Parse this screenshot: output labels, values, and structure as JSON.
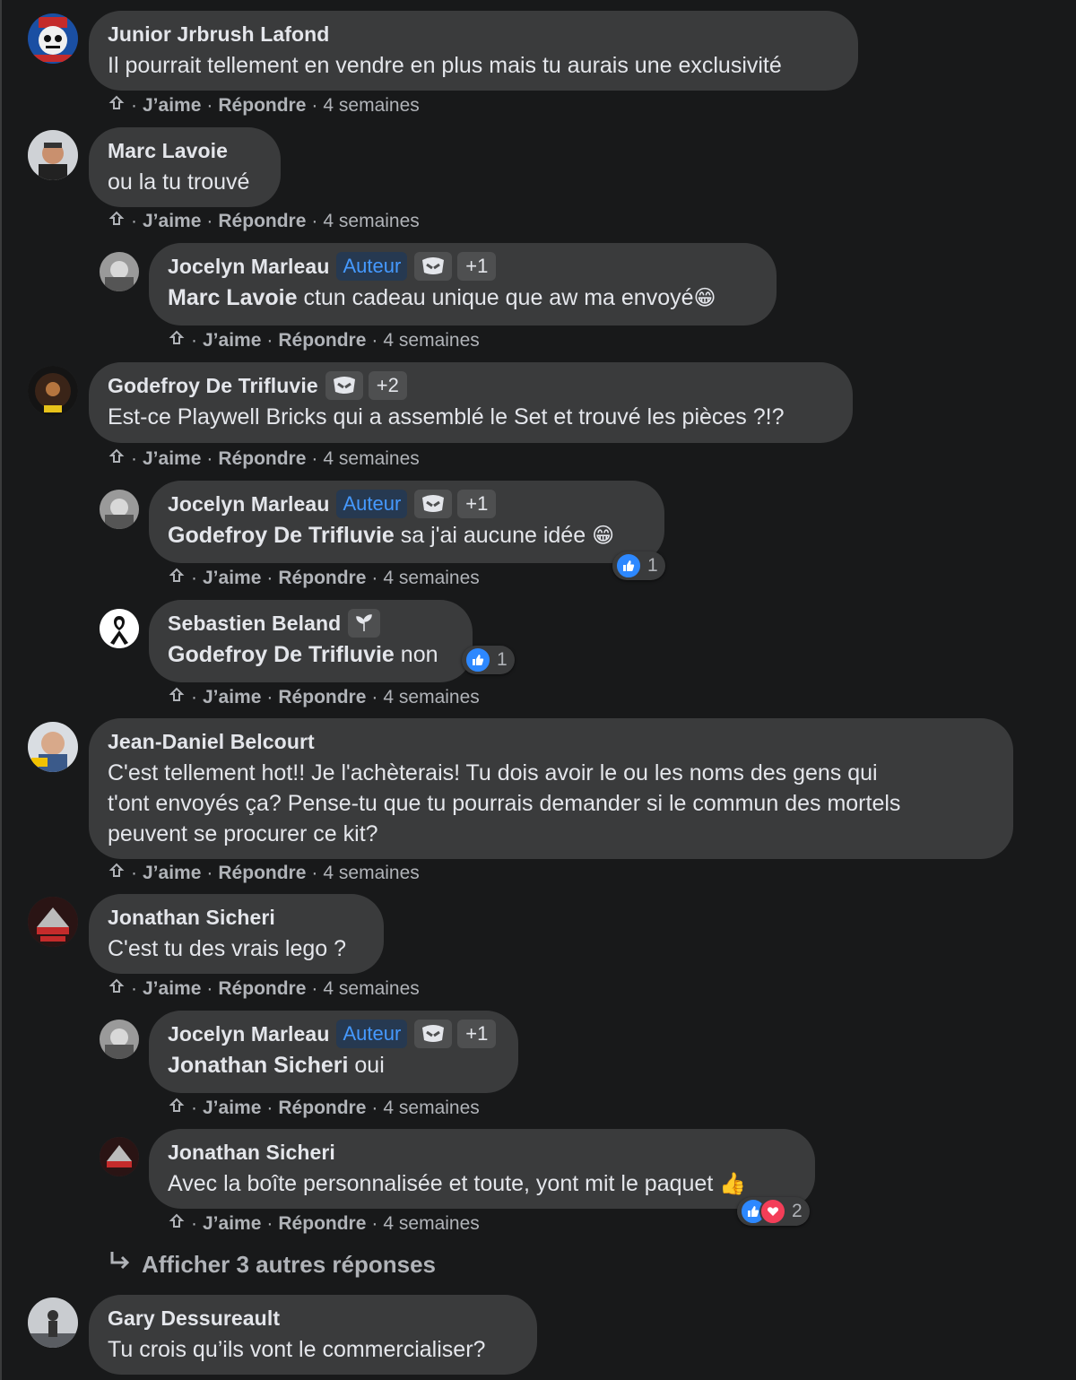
{
  "labels": {
    "like": "J’aime",
    "reply": "Répondre",
    "author_badge": "Auteur",
    "show_more": "Afficher 3 autres réponses"
  },
  "colors": {
    "background": "#18191a",
    "bubble": "#3a3b3c",
    "author_badge": "#4599ff",
    "like": "#2d88ff",
    "love": "#f33e58"
  },
  "comments": [
    {
      "name": "Junior Jrbrush Lafond",
      "text": "Il pourrait tellement en vendre en plus mais tu aurais une exclusivité",
      "time": "4 semaines"
    },
    {
      "name": "Marc Lavoie",
      "text": "ou la tu trouvé",
      "time": "4 semaines"
    },
    {
      "name": "Jocelyn Marleau",
      "badge_plus": "+1",
      "mention": "Marc Lavoie",
      "text": " ctun cadeau unique que aw ma envoyé",
      "emoji": "😁",
      "time": "4 semaines"
    },
    {
      "name": "Godefroy De Trifluvie",
      "badge_plus": "+2",
      "text": "Est-ce Playwell Bricks qui a assemblé le Set et trouvé les pièces ?!?",
      "time": "4 semaines"
    },
    {
      "name": "Jocelyn Marleau",
      "badge_plus": "+1",
      "mention": "Godefroy De Trifluvie",
      "text": " sa j'ai aucune idée",
      "emoji": "😁",
      "reactions": "1",
      "time": "4 semaines"
    },
    {
      "name": "Sebastien Beland",
      "mention": "Godefroy De Trifluvie",
      "text": " non",
      "reactions": "1",
      "time": "4 semaines"
    },
    {
      "name": "Jean-Daniel Belcourt",
      "text_lines": [
        "C'est tellement hot!! Je l'achèterais! Tu dois avoir le ou les noms des gens qui",
        "t'ont envoyés ça? Pense-tu que tu pourrais demander si le commun des mortels",
        "peuvent se procurer ce kit?"
      ],
      "time": "4 semaines"
    },
    {
      "name": "Jonathan Sicheri",
      "text": "C'est tu des vrais lego ?",
      "time": "4 semaines"
    },
    {
      "name": "Jocelyn Marleau",
      "badge_plus": "+1",
      "mention": "Jonathan Sicheri",
      "text": " oui",
      "time": "4 semaines"
    },
    {
      "name": "Jonathan Sicheri",
      "text": "Avec la boîte personnalisée et toute, yont mit le paquet",
      "emoji": "👍",
      "reactions": "2",
      "time": "4 semaines"
    },
    {
      "name": "Gary Dessureault",
      "text": "Tu crois qu’ils vont le commercialiser?"
    }
  ]
}
